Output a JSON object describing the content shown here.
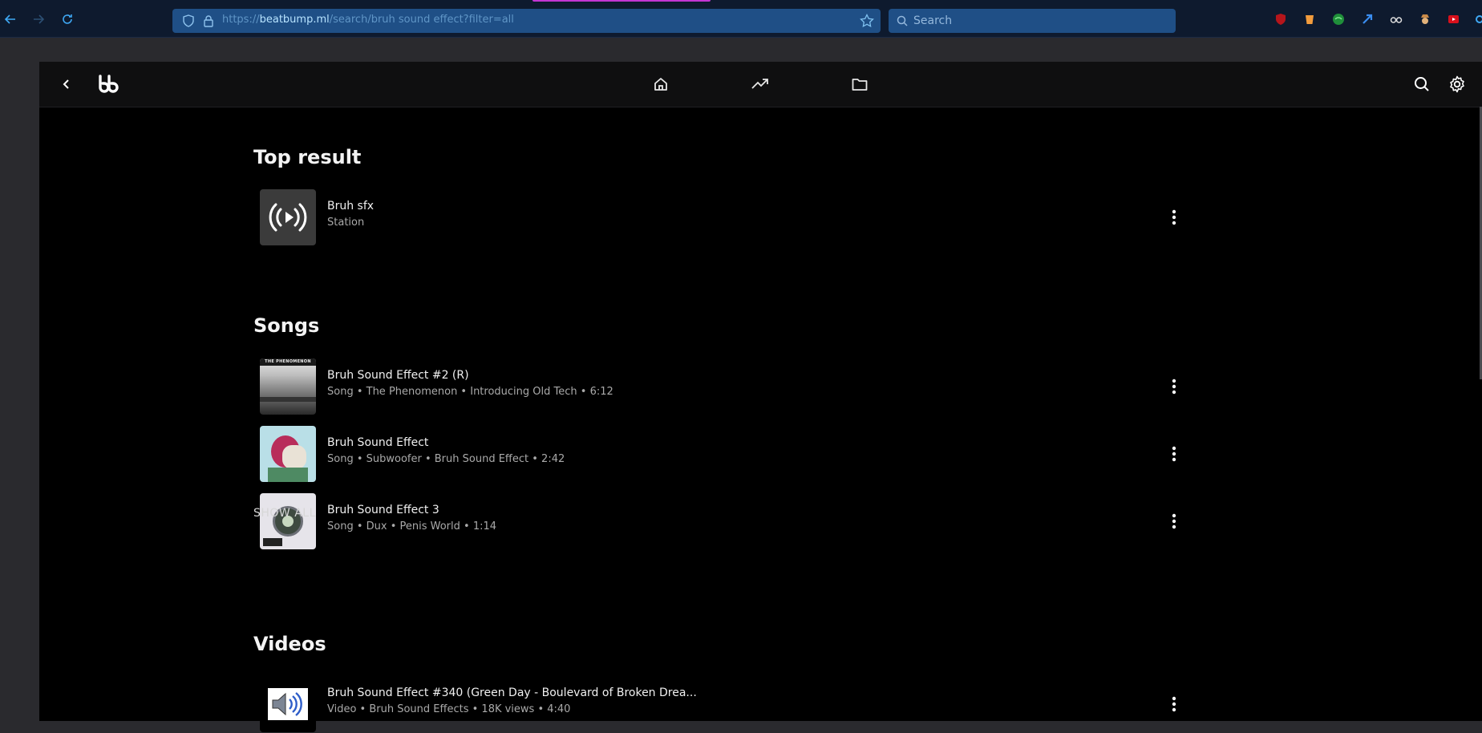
{
  "browser": {
    "url_host": "beatbump.ml",
    "url_path": "/search/bruh sound effect?filter=all",
    "url_scheme": "https://",
    "search_placeholder": "Search",
    "accent_color": "#c436d3"
  },
  "app": {
    "nav": {
      "back": "back-icon",
      "logo": "bb",
      "home": "home-icon",
      "trending": "trending-icon",
      "library": "folder-icon",
      "search": "search-icon",
      "settings": "gear-icon"
    },
    "sections": {
      "top_result": {
        "title": "Top result",
        "item": {
          "title": "Bruh sfx",
          "subtitle": "Station"
        }
      },
      "songs": {
        "title": "Songs",
        "items": [
          {
            "title": "Bruh Sound Effect #2 (R)",
            "subtitle": "Song • The Phenomenon • Introducing Old Tech • 6:12",
            "art_label": "THE PHENOMENON"
          },
          {
            "title": "Bruh Sound Effect",
            "subtitle": "Song • Subwoofer • Bruh Sound Effect • 2:42"
          },
          {
            "title": "Bruh Sound Effect 3",
            "subtitle": "Song • Dux • Penis World • 1:14"
          }
        ],
        "show_all": "SHOW ALL"
      },
      "videos": {
        "title": "Videos",
        "items": [
          {
            "title": "Bruh Sound Effect #340 (Green Day - Boulevard of Broken Drea...",
            "subtitle": "Video • Bruh Sound Effects • 18K views • 4:40"
          }
        ]
      }
    }
  }
}
